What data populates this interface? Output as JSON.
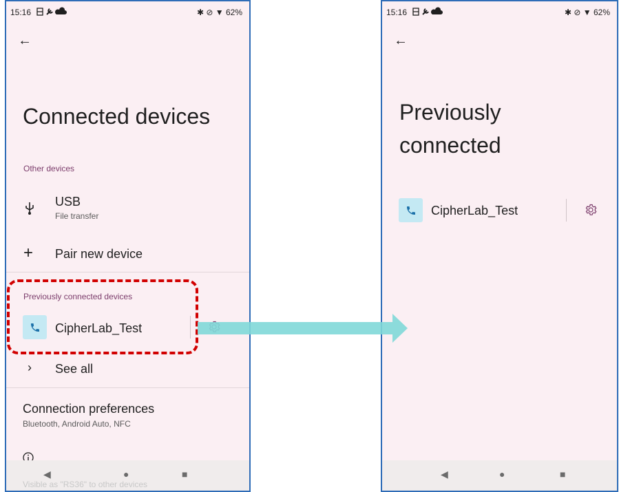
{
  "left": {
    "status": {
      "time": "15:16",
      "right": "✱ ⊘ ▼ 62%"
    },
    "title": "Connected devices",
    "other_devices_header": "Other devices",
    "usb": {
      "title": "USB",
      "subtitle": "File transfer"
    },
    "pair": {
      "label": "Pair new device"
    },
    "prev_header": "Previously connected devices",
    "device": {
      "name": "CipherLab_Test"
    },
    "see_all": "See all",
    "conn_prefs": {
      "title": "Connection preferences",
      "subtitle": "Bluetooth, Android Auto, NFC"
    },
    "visible_as": "Visible as \"RS36\" to other devices"
  },
  "right": {
    "status": {
      "time": "15:16",
      "right": "✱ ⊘ ▼ 62%"
    },
    "title_line1": "Previously",
    "title_line2": "connected",
    "device": {
      "name": "CipherLab_Test"
    }
  },
  "colors": {
    "accent": "#7b3c6b",
    "background": "#fbeff3",
    "highlight": "#d10000",
    "arrow": "#7fd8d8"
  }
}
